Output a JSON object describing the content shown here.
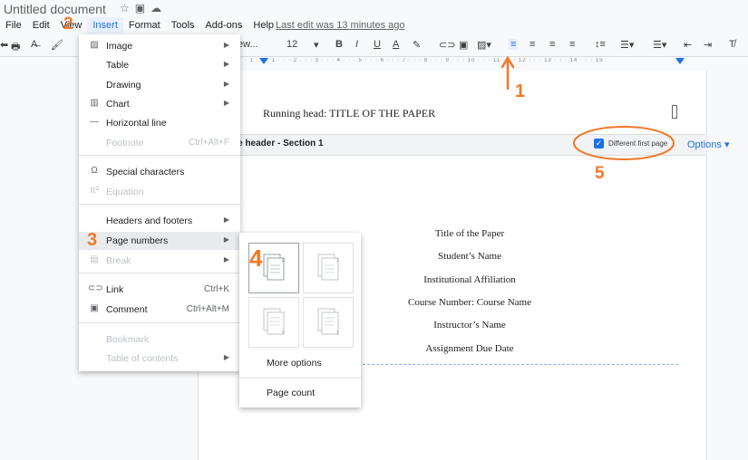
{
  "app": {
    "title": "Untitled document",
    "title_icons": [
      "star-icon",
      "folder-icon",
      "cloud-icon"
    ],
    "menu": [
      "File",
      "Edit",
      "View",
      "Insert",
      "Format",
      "Tools",
      "Add-ons",
      "Help"
    ],
    "last_edit": "Last edit was 13 minutes ago"
  },
  "toolbar": {
    "font": "ew...",
    "font_size": "12",
    "bold": "B",
    "italic": "I",
    "underline": "U",
    "text_color": "A"
  },
  "ruler": {
    "ticks": "· 1 · · · 1 · · · 2 · · · 3 · · · 4 · · · 5 · · · 6 · · · 7 · · · 8 · · · 9 · · · 10 · · · 11 · · · 12 · · · 13 · · · 14 · · · 15"
  },
  "document": {
    "running_head": "Running head: TITLE OF THE PAPER",
    "header_label": "ge header - Section 1",
    "different_first_page": "Different first page",
    "options": "Options ▾",
    "title_lines": [
      "Title of the Paper",
      "Student’s Name",
      "Institutional Affiliation",
      "Course Number: Course Name",
      "Instructor’s Name",
      "Assignment Due Date"
    ]
  },
  "insert_menu": {
    "items": [
      {
        "label": "Image",
        "icon": "image-icon",
        "arrow": "▶"
      },
      {
        "label": "Table",
        "arrow": "▶"
      },
      {
        "label": "Drawing",
        "arrow": "▶"
      },
      {
        "label": "Chart",
        "icon": "chart-icon",
        "arrow": "▶"
      },
      {
        "label": "Horizontal line",
        "icon": "horizontal-line-icon"
      },
      {
        "label": "Footnote",
        "shortcut": "Ctrl+Alt+F"
      },
      {
        "label": "Special characters",
        "icon": "omega-icon"
      },
      {
        "label": "Equation",
        "icon": "pi-icon"
      },
      {
        "label": "Headers and footers",
        "arrow": "▶"
      },
      {
        "label": "Page numbers",
        "arrow": "▶"
      },
      {
        "label": "Break",
        "icon": "break-icon",
        "arrow": "▶"
      },
      {
        "label": "Link",
        "icon": "link-icon",
        "shortcut": "Ctrl+K"
      },
      {
        "label": "Comment",
        "icon": "comment-icon",
        "shortcut": "Ctrl+Alt+M"
      },
      {
        "label": "Bookmark"
      },
      {
        "label": "Table of contents",
        "arrow": "▶"
      }
    ]
  },
  "page_numbers_submenu": {
    "more_options": "More options",
    "page_count": "Page count"
  },
  "annotations": [
    "1",
    "2",
    "3",
    "4",
    "5"
  ],
  "colors": {
    "accent": "#1a73e8",
    "annotation": "#f07828",
    "menu_highlight": "#e8eaed"
  }
}
